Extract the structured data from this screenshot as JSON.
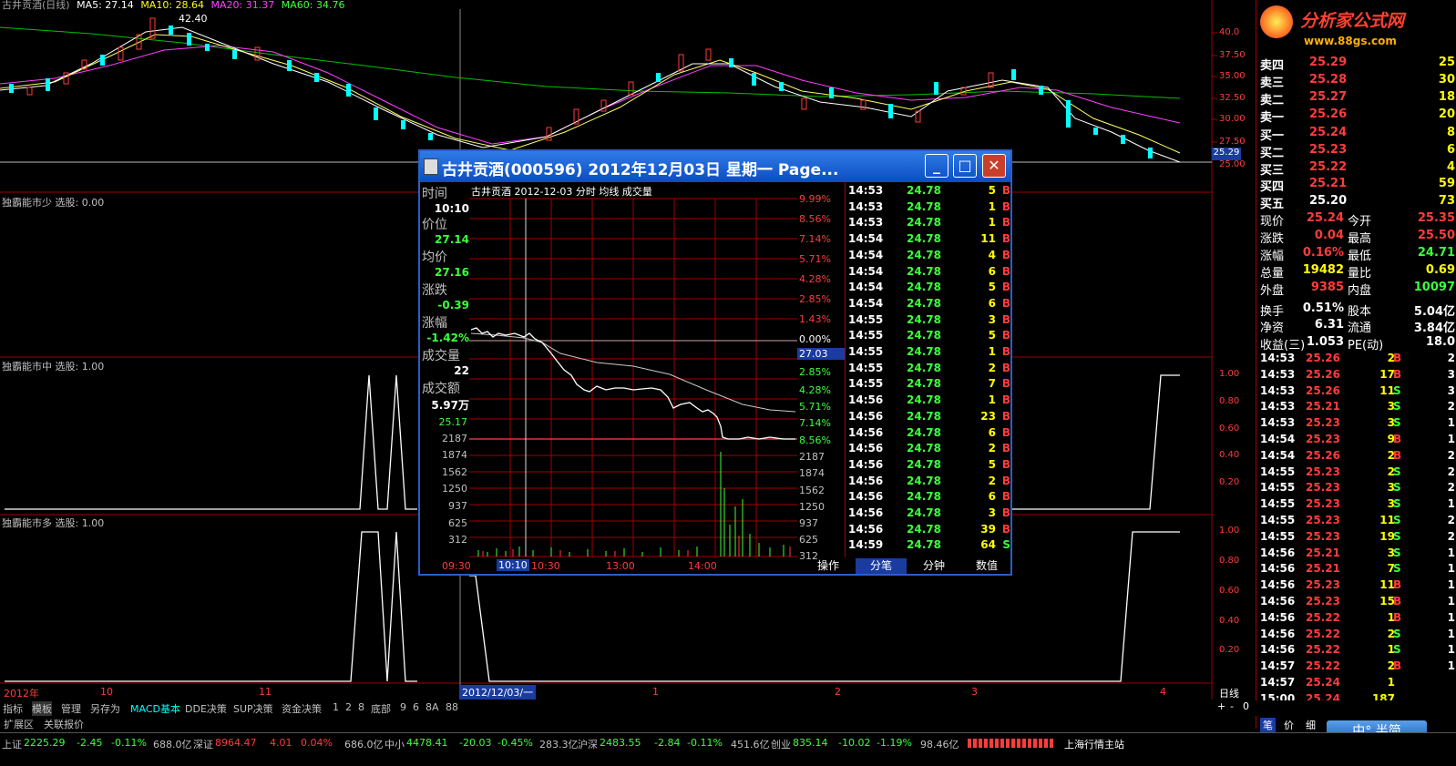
{
  "main": {
    "title": "古井贡酒(日线)",
    "ma": [
      {
        "label": "MA5: 27.14",
        "color": "#ffffff"
      },
      {
        "label": "MA10: 28.64",
        "color": "#ffff00"
      },
      {
        "label": "MA20: 31.37",
        "color": "#ff40ff"
      },
      {
        "label": "MA60: 34.76",
        "color": "#00ff00"
      }
    ],
    "high_label": "42.40",
    "price_axis": [
      "40.0",
      "37.50",
      "35.00",
      "32.50",
      "30.00",
      "27.50",
      "25.00"
    ],
    "current_price_tag": "25.29",
    "panel2_label": "独霸能市少  选股: 0.00",
    "panel3_label": "独霸能市中  选股: 1.00",
    "panel3_axis": [
      "1.00",
      "0.80",
      "0.60",
      "0.40",
      "0.20"
    ],
    "panel4_label": "独霸能市多  选股: 1.00",
    "panel4_axis": [
      "1.00",
      "0.80",
      "0.60",
      "0.40",
      "0.20"
    ],
    "date_axis": [
      "2012年",
      "10",
      "11",
      "2012/12/03/一",
      "1",
      "2",
      "3",
      "4"
    ],
    "period": "日线"
  },
  "popup": {
    "title": "古井贡酒(000596)  2012年12月03日  星期一  Page...",
    "header": "古井贡酒    2012-12-03 分时  均线  成交量",
    "header_cheng": "成",
    "labels": {
      "time": "时间",
      "time_val": "10:10",
      "price": "价位",
      "price_val": "27.14",
      "avg": "均价",
      "avg_val": "27.16",
      "chg": "涨跌",
      "chg_val": "-0.39",
      "pct": "涨幅",
      "pct_val": "-1.42%",
      "vol": "成交量",
      "vol_val": "22",
      "amt": "成交额",
      "amt_val": "5.97万"
    },
    "left_axis_vol": [
      "25.17",
      "2187",
      "1874",
      "1562",
      "1250",
      "937",
      "625",
      "312"
    ],
    "right_axis_pct": [
      "9.99%",
      "8.56%",
      "7.14%",
      "5.71%",
      "4.28%",
      "2.85%",
      "1.43%",
      "0.00%",
      "27.03",
      "2.85%",
      "4.28%",
      "5.71%",
      "7.14%",
      "8.56%",
      "2187",
      "1874",
      "1562",
      "1250",
      "937",
      "625",
      "312"
    ],
    "time_axis": [
      "09:30",
      "10:10",
      "10:30",
      "13:00",
      "14:00"
    ],
    "ticks": [
      [
        "14:53",
        "24.78",
        "5",
        "B"
      ],
      [
        "14:53",
        "24.78",
        "1",
        "B"
      ],
      [
        "14:53",
        "24.78",
        "1",
        "B"
      ],
      [
        "14:54",
        "24.78",
        "11",
        "B"
      ],
      [
        "14:54",
        "24.78",
        "4",
        "B"
      ],
      [
        "14:54",
        "24.78",
        "6",
        "B"
      ],
      [
        "14:54",
        "24.78",
        "5",
        "B"
      ],
      [
        "14:54",
        "24.78",
        "6",
        "B"
      ],
      [
        "14:55",
        "24.78",
        "3",
        "B"
      ],
      [
        "14:55",
        "24.78",
        "5",
        "B"
      ],
      [
        "14:55",
        "24.78",
        "1",
        "B"
      ],
      [
        "14:55",
        "24.78",
        "2",
        "B"
      ],
      [
        "14:55",
        "24.78",
        "7",
        "B"
      ],
      [
        "14:56",
        "24.78",
        "1",
        "B"
      ],
      [
        "14:56",
        "24.78",
        "23",
        "B"
      ],
      [
        "14:56",
        "24.78",
        "6",
        "B"
      ],
      [
        "14:56",
        "24.78",
        "2",
        "B"
      ],
      [
        "14:56",
        "24.78",
        "5",
        "B"
      ],
      [
        "14:56",
        "24.78",
        "2",
        "B"
      ],
      [
        "14:56",
        "24.78",
        "6",
        "B"
      ],
      [
        "14:56",
        "24.78",
        "3",
        "B"
      ],
      [
        "14:56",
        "24.78",
        "39",
        "B"
      ],
      [
        "14:59",
        "24.78",
        "64",
        "S"
      ]
    ],
    "tabs": [
      "操作",
      "分笔",
      "分钟",
      "数值"
    ]
  },
  "quote": {
    "logo": "分析家公式网",
    "logo_url": "www.88gs.com",
    "asks": [
      [
        "卖四",
        "25.29",
        "25"
      ],
      [
        "卖三",
        "25.28",
        "30"
      ],
      [
        "卖二",
        "25.27",
        "18"
      ],
      [
        "卖一",
        "25.26",
        "20"
      ]
    ],
    "bids": [
      [
        "买一",
        "25.24",
        "8"
      ],
      [
        "买二",
        "25.23",
        "6"
      ],
      [
        "买三",
        "25.22",
        "4"
      ],
      [
        "买四",
        "25.21",
        "59"
      ],
      [
        "买五",
        "25.20",
        "73"
      ]
    ],
    "stats": [
      [
        "现价",
        "25.24",
        "今开",
        "25.35"
      ],
      [
        "涨跌",
        "0.04",
        "最高",
        "25.50"
      ],
      [
        "涨幅",
        "0.16%",
        "最低",
        "24.71"
      ],
      [
        "总量",
        "19482",
        "量比",
        "0.69"
      ],
      [
        "外盘",
        "9385",
        "内盘",
        "10097"
      ],
      [
        "换手",
        "0.51%",
        "股本",
        "5.04亿"
      ],
      [
        "净资",
        "6.31",
        "流通",
        "3.84亿"
      ],
      [
        "收益(三)",
        "1.053",
        "PE(动)",
        "18.0"
      ]
    ],
    "trades": [
      [
        "14:53",
        "25.26",
        "2",
        "B",
        "2"
      ],
      [
        "14:53",
        "25.26",
        "17",
        "B",
        "3"
      ],
      [
        "14:53",
        "25.26",
        "11",
        "S",
        "3"
      ],
      [
        "14:53",
        "25.21",
        "3",
        "S",
        "2"
      ],
      [
        "14:53",
        "25.23",
        "3",
        "S",
        "1"
      ],
      [
        "14:54",
        "25.23",
        "9",
        "B",
        "1"
      ],
      [
        "14:54",
        "25.26",
        "2",
        "B",
        "2"
      ],
      [
        "14:55",
        "25.23",
        "2",
        "S",
        "2"
      ],
      [
        "14:55",
        "25.23",
        "3",
        "S",
        "2"
      ],
      [
        "14:55",
        "25.23",
        "3",
        "S",
        "1"
      ],
      [
        "14:55",
        "25.23",
        "11",
        "S",
        "2"
      ],
      [
        "14:55",
        "25.23",
        "19",
        "S",
        "2"
      ],
      [
        "14:56",
        "25.21",
        "3",
        "S",
        "1"
      ],
      [
        "14:56",
        "25.21",
        "7",
        "S",
        "1"
      ],
      [
        "14:56",
        "25.23",
        "11",
        "B",
        "1"
      ],
      [
        "14:56",
        "25.23",
        "15",
        "B",
        "1"
      ],
      [
        "14:56",
        "25.22",
        "1",
        "B",
        "1"
      ],
      [
        "14:56",
        "25.22",
        "2",
        "S",
        "1"
      ],
      [
        "14:56",
        "25.22",
        "1",
        "S",
        "1"
      ],
      [
        "14:57",
        "25.22",
        "2",
        "B",
        "1"
      ],
      [
        "14:57",
        "25.24",
        "1",
        "",
        ""
      ],
      [
        "15:00",
        "25.24",
        "187",
        "",
        ""
      ]
    ],
    "bottom_tabs": [
      "笔",
      "价",
      "细"
    ],
    "ime": "中°,半简"
  },
  "toolbar": {
    "items": [
      "指标",
      "模板",
      "管理",
      "另存为",
      "MACD基本",
      "DDE决策",
      "SUP决策",
      "资金决策",
      "1",
      "2",
      "8",
      "底部",
      "9",
      "6",
      "8A",
      "88"
    ],
    "row2": [
      "扩展区",
      "关联报价"
    ],
    "zoom": [
      "+",
      "-",
      "0"
    ]
  },
  "status": {
    "sh_label": "上证",
    "sh_val": "2225.29",
    "sh_chg": "-2.45",
    "sh_pct": "-0.11%",
    "sh_amt": "688.0亿",
    "sz_label": "深证",
    "sz_val": "8964.47",
    "sz_chg": "4.01",
    "sz_pct": "0.04%",
    "sz_amt": "686.0亿",
    "zx_label": "中小",
    "zx_val": "4478.41",
    "zx_chg": "-20.03",
    "zx_pct": "-0.45%",
    "zx_amt": "283.3亿",
    "hs_label": "沪深",
    "hs_val": "2483.55",
    "hs_chg": "-2.84",
    "hs_pct": "-0.11%",
    "hs_amt": "451.6亿",
    "cy_label": "创业",
    "cy_val": "835.14",
    "cy_chg": "-10.02",
    "cy_pct": "-1.19%",
    "cy_amt": "98.46亿",
    "server": "上海行情主站"
  }
}
